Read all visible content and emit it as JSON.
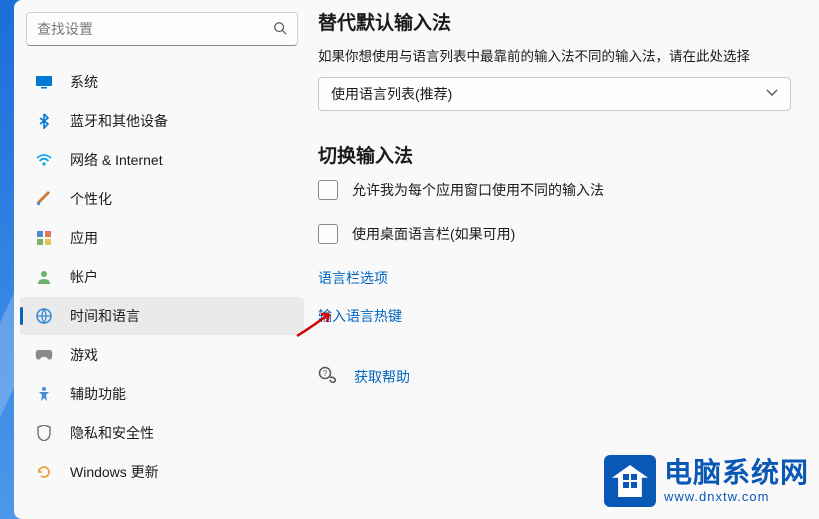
{
  "search": {
    "placeholder": "查找设置"
  },
  "sidebar": {
    "items": [
      {
        "label": "系统"
      },
      {
        "label": "蓝牙和其他设备"
      },
      {
        "label": "网络 & Internet"
      },
      {
        "label": "个性化"
      },
      {
        "label": "应用"
      },
      {
        "label": "帐户"
      },
      {
        "label": "时间和语言"
      },
      {
        "label": "游戏"
      },
      {
        "label": "辅助功能"
      },
      {
        "label": "隐私和安全性"
      },
      {
        "label": "Windows 更新"
      }
    ]
  },
  "content": {
    "section1_title": "替代默认输入法",
    "section1_desc": "如果你想使用与语言列表中最靠前的输入法不同的输入法，请在此处选择",
    "dropdown_value": "使用语言列表(推荐)",
    "section2_title": "切换输入法",
    "checkbox1": "允许我为每个应用窗口使用不同的输入法",
    "checkbox2": "使用桌面语言栏(如果可用)",
    "link1": "语言栏选项",
    "link2": "输入语言热键",
    "help_label": "获取帮助"
  },
  "watermark": {
    "title": "电脑系统网",
    "url": "www.dnxtw.com"
  }
}
